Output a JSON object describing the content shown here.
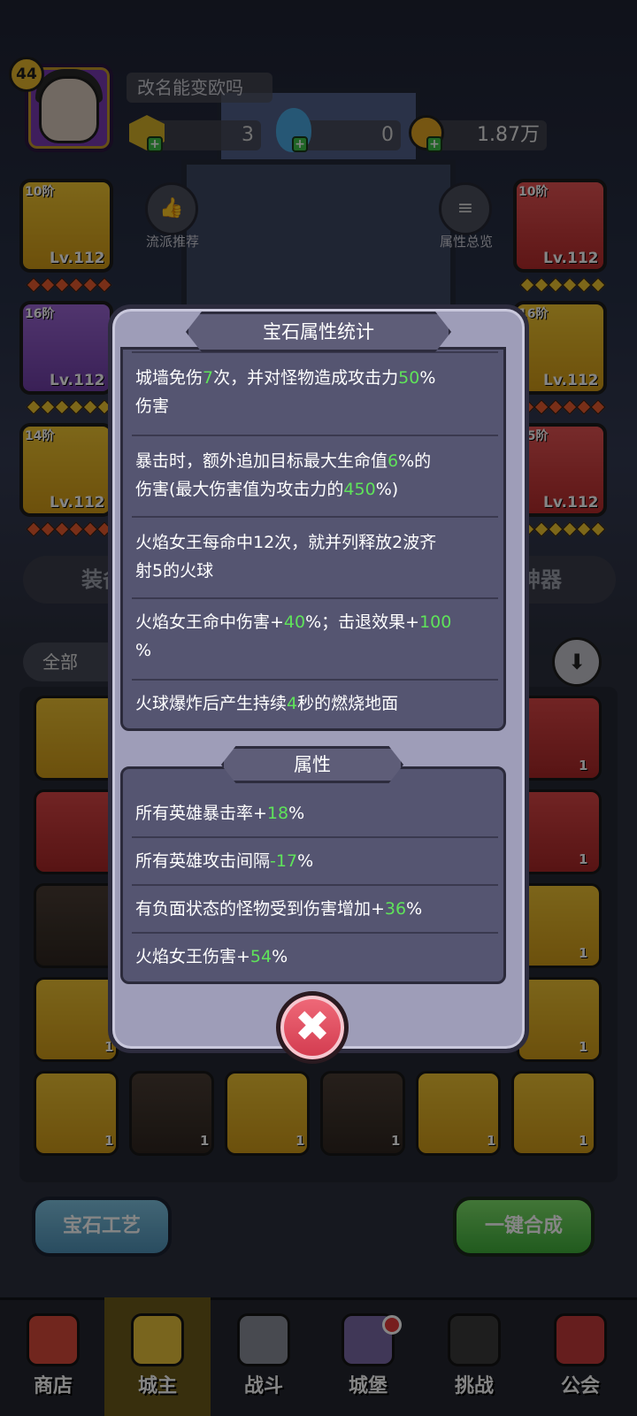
{
  "header": {
    "player_level": "44",
    "player_name": "改名能变欧吗",
    "resources": {
      "gem": "3",
      "potion": "0",
      "gold": "1.87万"
    }
  },
  "equipment": {
    "left": [
      {
        "tier": "10阶",
        "level": "Lv.112",
        "color": "gold"
      },
      {
        "tier": "16阶",
        "level": "Lv.112",
        "color": "purple"
      },
      {
        "tier": "14阶",
        "level": "Lv.112",
        "color": "gold"
      }
    ],
    "right": [
      {
        "tier": "10阶",
        "level": "Lv.112",
        "color": "red"
      },
      {
        "tier": "16阶",
        "level": "Lv.112",
        "color": "gold"
      },
      {
        "tier": "15阶",
        "level": "Lv.112",
        "color": "red"
      }
    ],
    "build_recommend_label": "流派推荐",
    "attr_overview_label": "属性总览"
  },
  "tabs": {
    "equip": "装备",
    "artifact": "神器"
  },
  "filter": {
    "selected": "全部"
  },
  "gem_counts": [
    "1",
    "1",
    "1",
    "1",
    "1",
    "1",
    "1",
    "1",
    "1",
    "1",
    "1",
    "1"
  ],
  "buttons": {
    "craft": "宝石工艺",
    "merge": "一键合成"
  },
  "nav": {
    "shop": "商店",
    "lord": "城主",
    "battle": "战斗",
    "castle": "城堡",
    "challenge": "挑战",
    "guild": "公会"
  },
  "modal": {
    "title": "宝石属性统计",
    "effects": [
      {
        "parts": [
          "城墙免伤",
          "7",
          "次，并对怪物造成攻击力",
          "50",
          "%\n伤害"
        ]
      },
      {
        "parts": [
          "暴击时，额外追加目标最大生命值",
          "6",
          "%的\n伤害(最大伤害值为攻击力的",
          "450",
          "%)"
        ]
      },
      {
        "parts": [
          "火焰女王每命中12次，就并列释放2波齐\n射5的火球"
        ]
      },
      {
        "parts": [
          "火焰女王命中伤害+",
          "40",
          "%；击退效果+",
          "100",
          "\n%"
        ]
      },
      {
        "parts": [
          "火球爆炸后产生持续",
          "4",
          "秒的燃烧地面"
        ]
      }
    ],
    "attr_header": "属性",
    "attributes": [
      {
        "parts": [
          "所有英雄暴击率+",
          "18",
          "%"
        ]
      },
      {
        "parts": [
          "所有英雄攻击间隔",
          "-17",
          "%"
        ]
      },
      {
        "parts": [
          "有负面状态的怪物受到伤害增加+",
          "36",
          "%"
        ]
      },
      {
        "parts": [
          "火焰女王伤害+",
          "54",
          "%"
        ]
      }
    ],
    "highlight_color": "#5fe35a"
  }
}
